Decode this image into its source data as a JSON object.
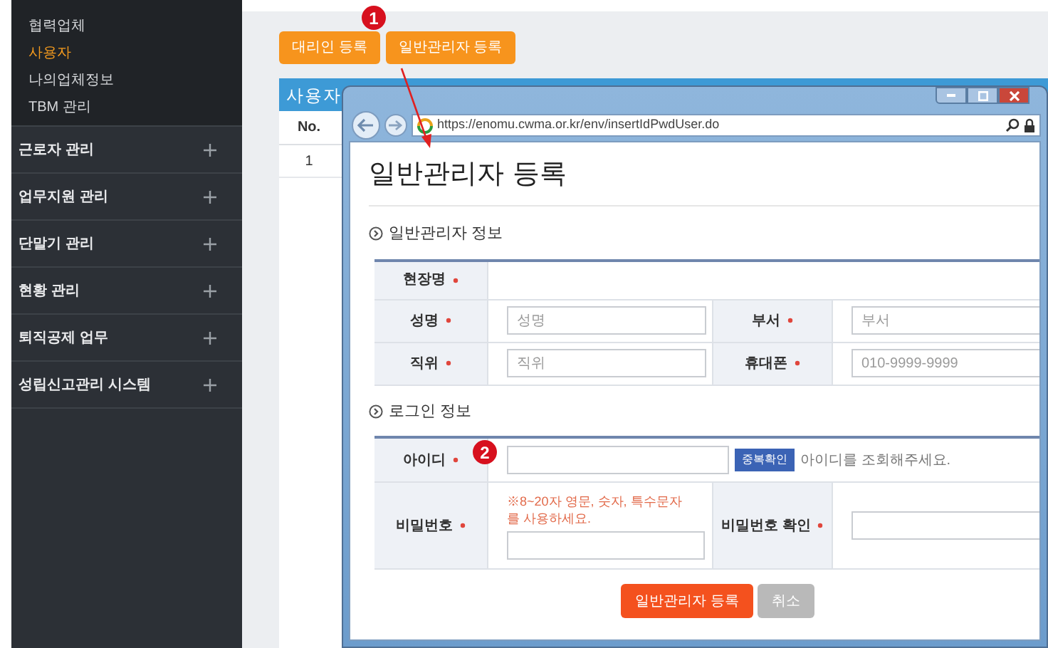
{
  "sidebar": {
    "sub_items": [
      {
        "label": "협력업체",
        "selected": false
      },
      {
        "label": "사용자",
        "selected": true
      },
      {
        "label": "나의업체정보",
        "selected": false
      },
      {
        "label": "TBM 관리",
        "selected": false
      }
    ],
    "menu": [
      {
        "label": "근로자 관리",
        "expanded": false
      },
      {
        "label": "업무지원 관리",
        "expanded": false
      },
      {
        "label": "단말기 관리",
        "expanded": false
      },
      {
        "label": "현황 관리",
        "expanded": false
      },
      {
        "label": "퇴직공제 업무",
        "expanded": false
      },
      {
        "label": "성립신고관리 시스템",
        "expanded": false
      }
    ]
  },
  "toolbar": {
    "buttons": [
      {
        "label": "대리인 등록"
      },
      {
        "label": "일반관리자 등록"
      }
    ]
  },
  "user_table": {
    "title": "사용자",
    "columns": [
      "No."
    ],
    "rows": [
      [
        "1"
      ]
    ]
  },
  "annotations": [
    {
      "label": "1"
    },
    {
      "label": "2"
    }
  ],
  "popup": {
    "url": "https://enomu.cwma.or.kr/env/insertIdPwdUser.do",
    "title": "일반관리자 등록",
    "info_section": {
      "title": "일반관리자 정보",
      "site": {
        "label": "현장명",
        "required": true
      },
      "rows": [
        [
          {
            "label": "성명",
            "required": true,
            "placeholder": "성명"
          },
          {
            "label": "부서",
            "required": true,
            "placeholder": "부서"
          }
        ],
        [
          {
            "label": "직위",
            "required": true,
            "placeholder": "직위"
          },
          {
            "label": "휴대폰",
            "required": true,
            "placeholder": "010-9999-9999"
          }
        ]
      ]
    },
    "login_section": {
      "title": "로그인 정보",
      "id": {
        "label": "아이디",
        "required": true,
        "button": "중복확인",
        "hint": "아이디를 조회해주세요."
      },
      "password": {
        "label": "비밀번호",
        "required": true,
        "note": "※8~20자 영문, 숫자, 특수문자를 사용하세요."
      },
      "confirm": {
        "label": "비밀번호 확인",
        "required": true
      }
    },
    "buttons": [
      {
        "label": "일반관리자 등록",
        "kind": "primary"
      },
      {
        "label": "취소",
        "kind": "secondary"
      }
    ]
  }
}
